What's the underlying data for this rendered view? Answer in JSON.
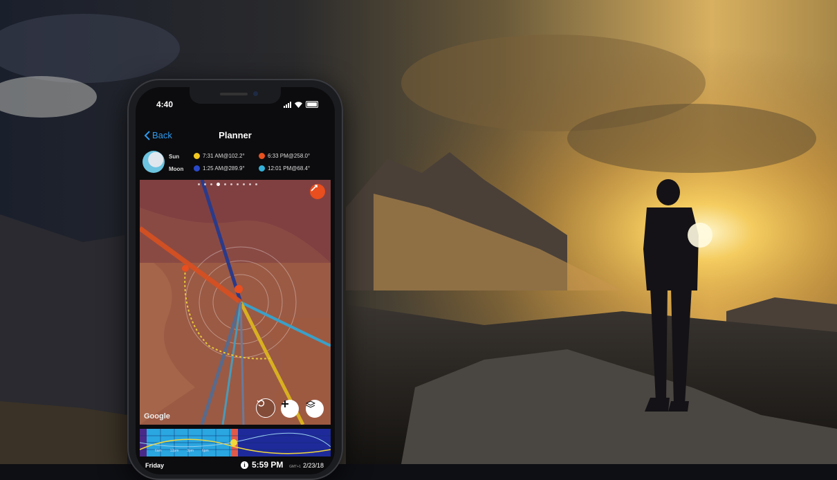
{
  "status": {
    "time": "4:40"
  },
  "nav": {
    "back_label": "Back",
    "title": "Planner"
  },
  "ephemeris": {
    "sun_label": "Sun",
    "moon_label": "Moon",
    "sunrise": "7:31 AM@102.2°",
    "sunset": "6:33 PM@258.0°",
    "moonrise": "1:25 AM@289.9°",
    "moonset": "12:01 PM@68.4°",
    "colors": {
      "sunrise": "#f2c81e",
      "sunset": "#e8511e",
      "moonrise": "#2a49c8",
      "moonset": "#34b0d8"
    }
  },
  "map": {
    "attribution": "Google",
    "page_indicator_count": 10,
    "page_indicator_active": 3
  },
  "timeline": {
    "hour_labels": [
      "6am",
      "12pm",
      "3pm",
      "6pm"
    ]
  },
  "footer": {
    "day": "Friday",
    "time": "5:59 PM",
    "timezone": "GMT+1",
    "date": "2/23/18"
  },
  "icons": {
    "back": "chevron-left-icon",
    "compass": "compass-icon",
    "undo": "undo-icon",
    "add": "plus-icon",
    "layers": "layers-icon",
    "info": "info-icon"
  }
}
